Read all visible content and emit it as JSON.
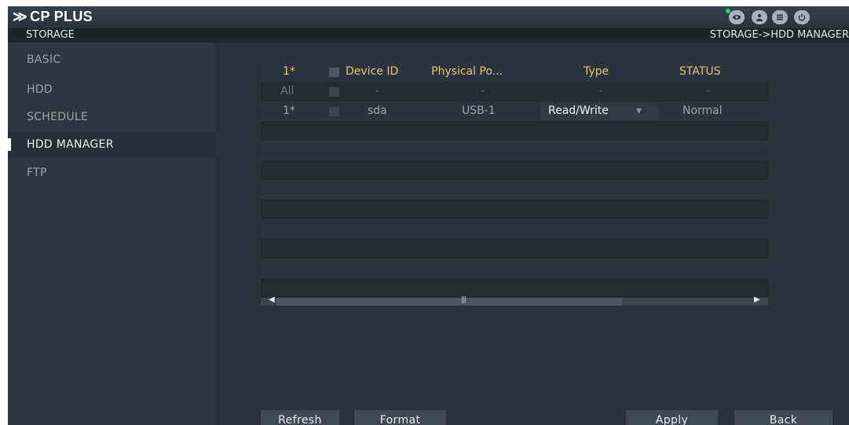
{
  "app": {
    "brand": "CP PLUS",
    "section": "STORAGE",
    "breadcrumb": "STORAGE->HDD MANAGER",
    "top_icons": [
      "live-view-icon",
      "user-icon",
      "menu-icon",
      "power-icon"
    ]
  },
  "sidebar": {
    "items": [
      {
        "label": "BASIC",
        "active": false
      },
      {
        "label": "HDD",
        "active": false
      },
      {
        "label": "SCHEDULE",
        "active": false
      },
      {
        "label": "HDD MANAGER",
        "active": true
      },
      {
        "label": "FTP",
        "active": false
      }
    ]
  },
  "table": {
    "headers": {
      "index": "1*",
      "device_id": "Device ID",
      "physical_port": "Physical Po...",
      "type": "Type",
      "status": "STATUS"
    },
    "all_row": {
      "index": "All",
      "device_id": "-",
      "physical_port": "-",
      "type": "-",
      "status": "-"
    },
    "rows": [
      {
        "index": "1*",
        "device_id": "sda",
        "physical_port": "USB-1",
        "type": "Read/Write",
        "status": "Normal"
      }
    ]
  },
  "buttons": {
    "refresh": "Refresh",
    "format": "Format",
    "apply": "Apply",
    "back": "Back"
  },
  "colors": {
    "header_text": "#e9c46a",
    "background": "#28323c",
    "accent_green": "#27d36b"
  }
}
